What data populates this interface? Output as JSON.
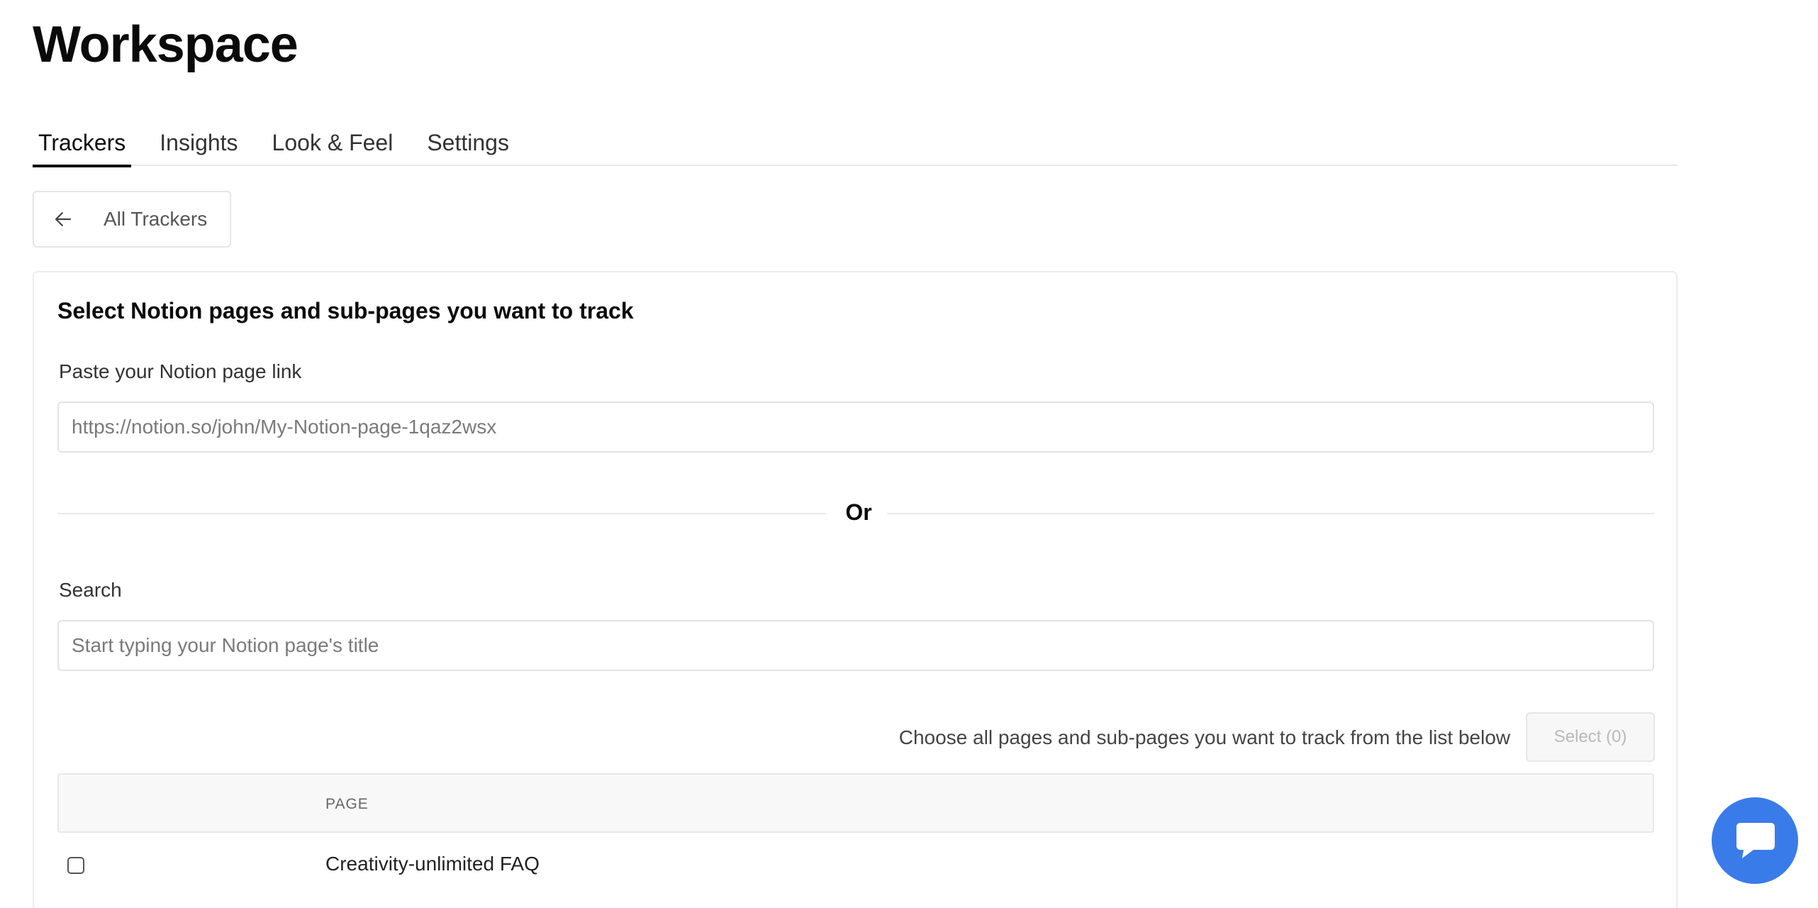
{
  "page": {
    "title": "Workspace"
  },
  "tabs": [
    {
      "label": "Trackers",
      "active": true
    },
    {
      "label": "Insights",
      "active": false
    },
    {
      "label": "Look & Feel",
      "active": false
    },
    {
      "label": "Settings",
      "active": false
    }
  ],
  "back_button": {
    "label": "All Trackers",
    "icon": "arrow-left-icon"
  },
  "card": {
    "title": "Select Notion pages and sub-pages you want to track",
    "link_field": {
      "label": "Paste your Notion page link",
      "placeholder": "https://notion.so/john/My-Notion-page-1qaz2wsx",
      "value": ""
    },
    "divider_text": "Or",
    "search_field": {
      "label": "Search",
      "placeholder": "Start typing your Notion page's title",
      "value": ""
    },
    "choose_text": "Choose all pages and sub-pages you want to track from the list below",
    "select_button_label": "Select (0)",
    "table": {
      "columns": [
        "PAGE"
      ],
      "rows": [
        {
          "page": "Creativity-unlimited FAQ",
          "checked": false
        }
      ]
    }
  },
  "chat_widget": {
    "icon": "chat-bubble-icon",
    "color": "#3a7bea"
  }
}
